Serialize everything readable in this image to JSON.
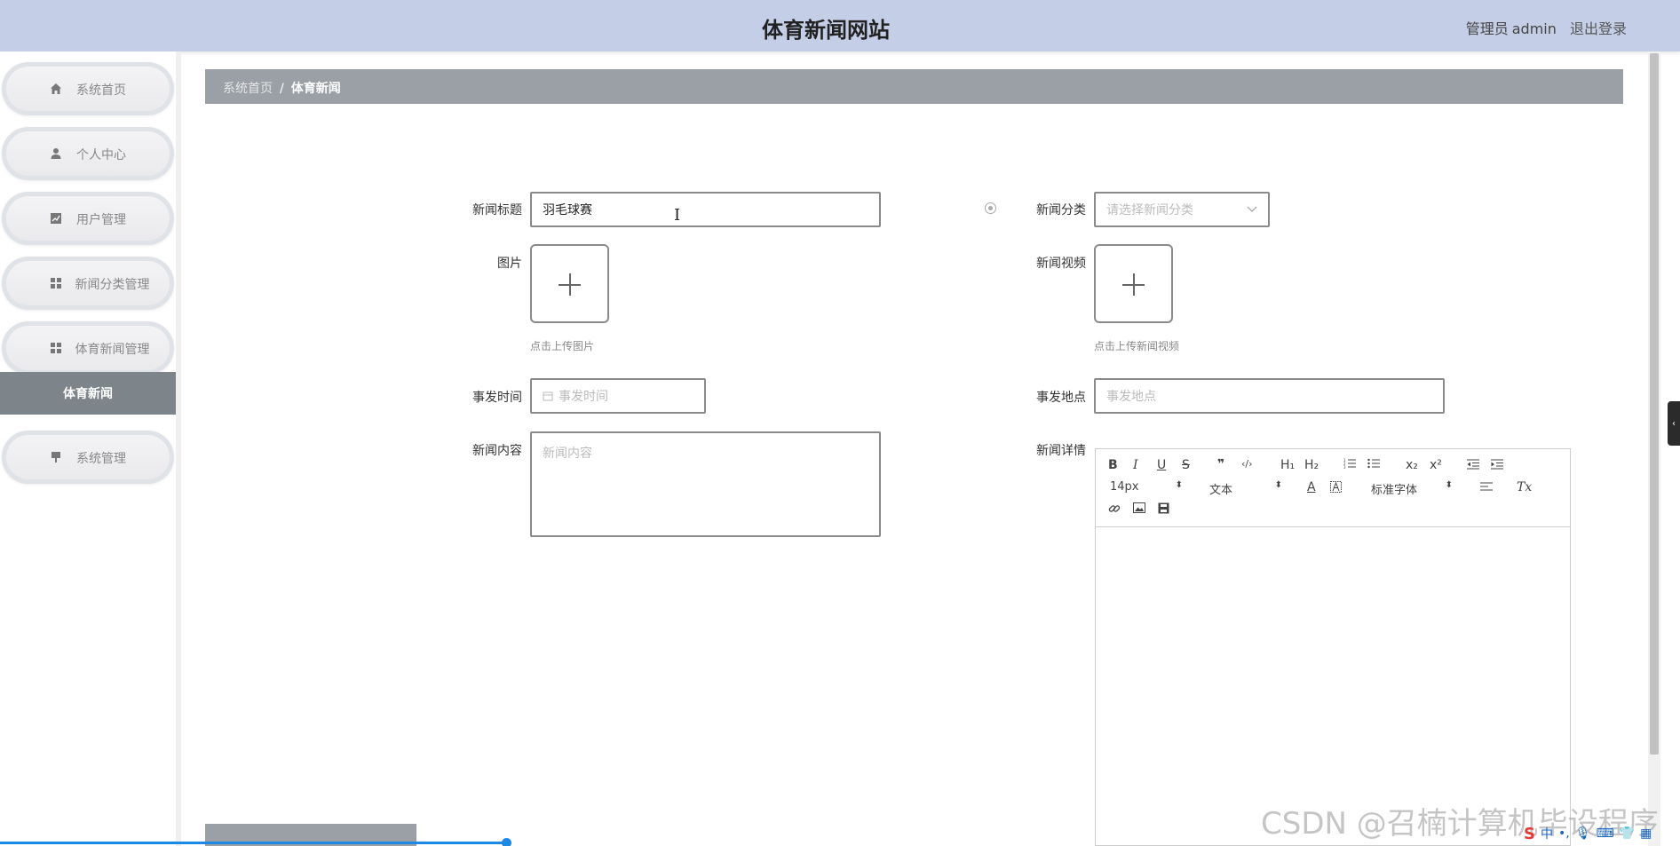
{
  "header": {
    "title": "体育新闻网站",
    "user_role": "管理员",
    "username": "admin",
    "logout_label": "退出登录"
  },
  "sidebar": {
    "items": [
      {
        "label": "系统首页",
        "icon": "home-icon"
      },
      {
        "label": "个人中心",
        "icon": "user-icon"
      },
      {
        "label": "用户管理",
        "icon": "chart-icon"
      },
      {
        "label": "新闻分类管理",
        "icon": "grid-icon"
      },
      {
        "label": "体育新闻管理",
        "icon": "grid-icon"
      },
      {
        "label": "系统管理",
        "icon": "pin-icon"
      }
    ],
    "active_sub": "体育新闻"
  },
  "breadcrumb": {
    "home": "系统首页",
    "separator": "/",
    "current": "体育新闻"
  },
  "form": {
    "title_label": "新闻标题",
    "title_value": "羽毛球赛",
    "category_label": "新闻分类",
    "category_placeholder": "请选择新闻分类",
    "image_label": "图片",
    "image_hint": "点击上传图片",
    "video_label": "新闻视频",
    "video_hint": "点击上传新闻视频",
    "time_label": "事发时间",
    "time_placeholder": "事发时间",
    "place_label": "事发地点",
    "place_placeholder": "事发地点",
    "content_label": "新闻内容",
    "content_placeholder": "新闻内容",
    "detail_label": "新闻详情"
  },
  "editor": {
    "font_size": "14px",
    "paragraph": "文本",
    "font_family": "标准字体",
    "buttons": {
      "bold": "B",
      "italic": "I",
      "underline": "U",
      "strike": "S",
      "quote": "❞",
      "code": "‹/›",
      "h1": "H₁",
      "h2": "H₂",
      "sub": "x₂",
      "sup": "x²",
      "color": "A",
      "clear": "Tx"
    }
  },
  "watermark": "CSDN @召楠计算机毕设程序",
  "ime": {
    "logo": "S",
    "mode": "中"
  }
}
